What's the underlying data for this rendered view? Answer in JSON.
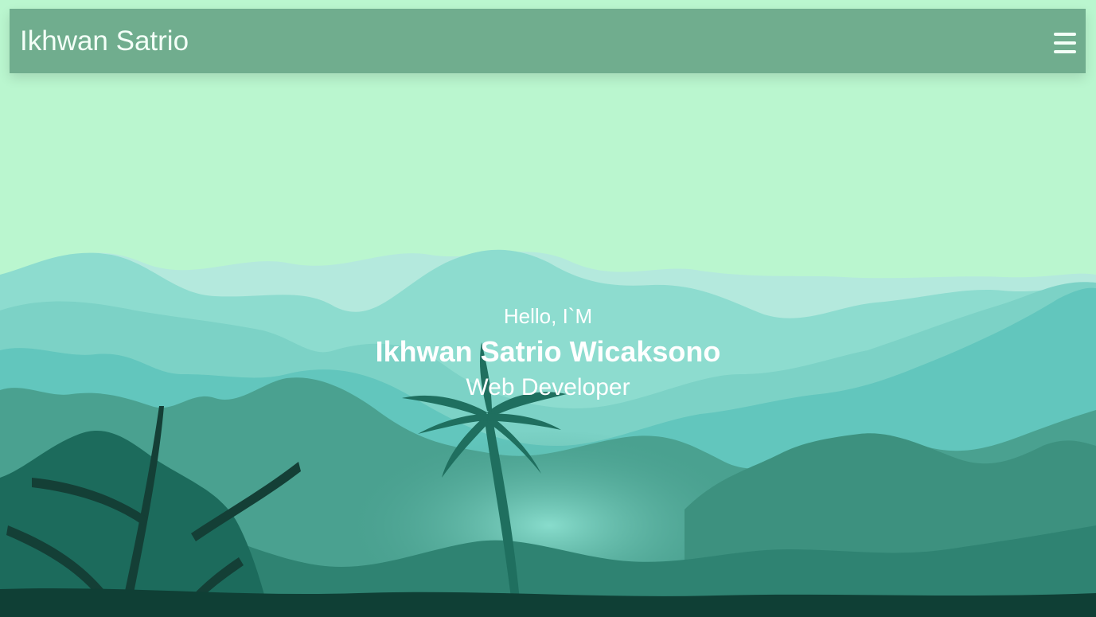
{
  "navbar": {
    "brand": "Ikhwan Satrio",
    "menu_icon": "hamburger-menu-icon"
  },
  "hero": {
    "greeting": "Hello, I`M",
    "name": "Ikhwan Satrio Wicaksono",
    "role": "Web Developer"
  },
  "colors": {
    "sky": "#baf6cf",
    "navbar": "#70ad8e",
    "far_hills": "#b4e9dd",
    "mid_hills": "#8ddccf",
    "teal_hills": "#62c6bd",
    "forest": "#4aa190",
    "dark_forest": "#1c6b5c",
    "foreground": "#0f3f35"
  }
}
